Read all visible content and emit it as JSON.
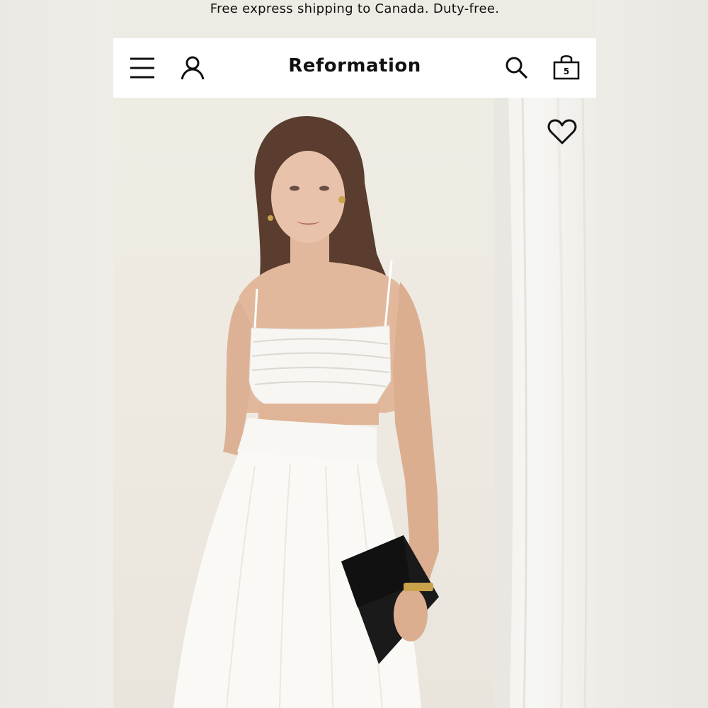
{
  "promo": {
    "text": "Free express shipping to Canada. Duty-free."
  },
  "header": {
    "logo": "Reformation",
    "menu_icon": "hamburger-menu-icon",
    "account_icon": "person-icon",
    "search_icon": "search-icon",
    "bag_icon": "shopping-bag-icon",
    "bag_count": "5"
  },
  "product_gallery": {
    "main_image": "model-in-white-linen-crop-top-and-skirt",
    "next_image": "white-linen-fabric-closeup",
    "favorite_icon": "heart-outline-icon"
  },
  "colors": {
    "header_bg": "#ffffff",
    "promo_bg": "#eeebe4",
    "text": "#111111"
  }
}
